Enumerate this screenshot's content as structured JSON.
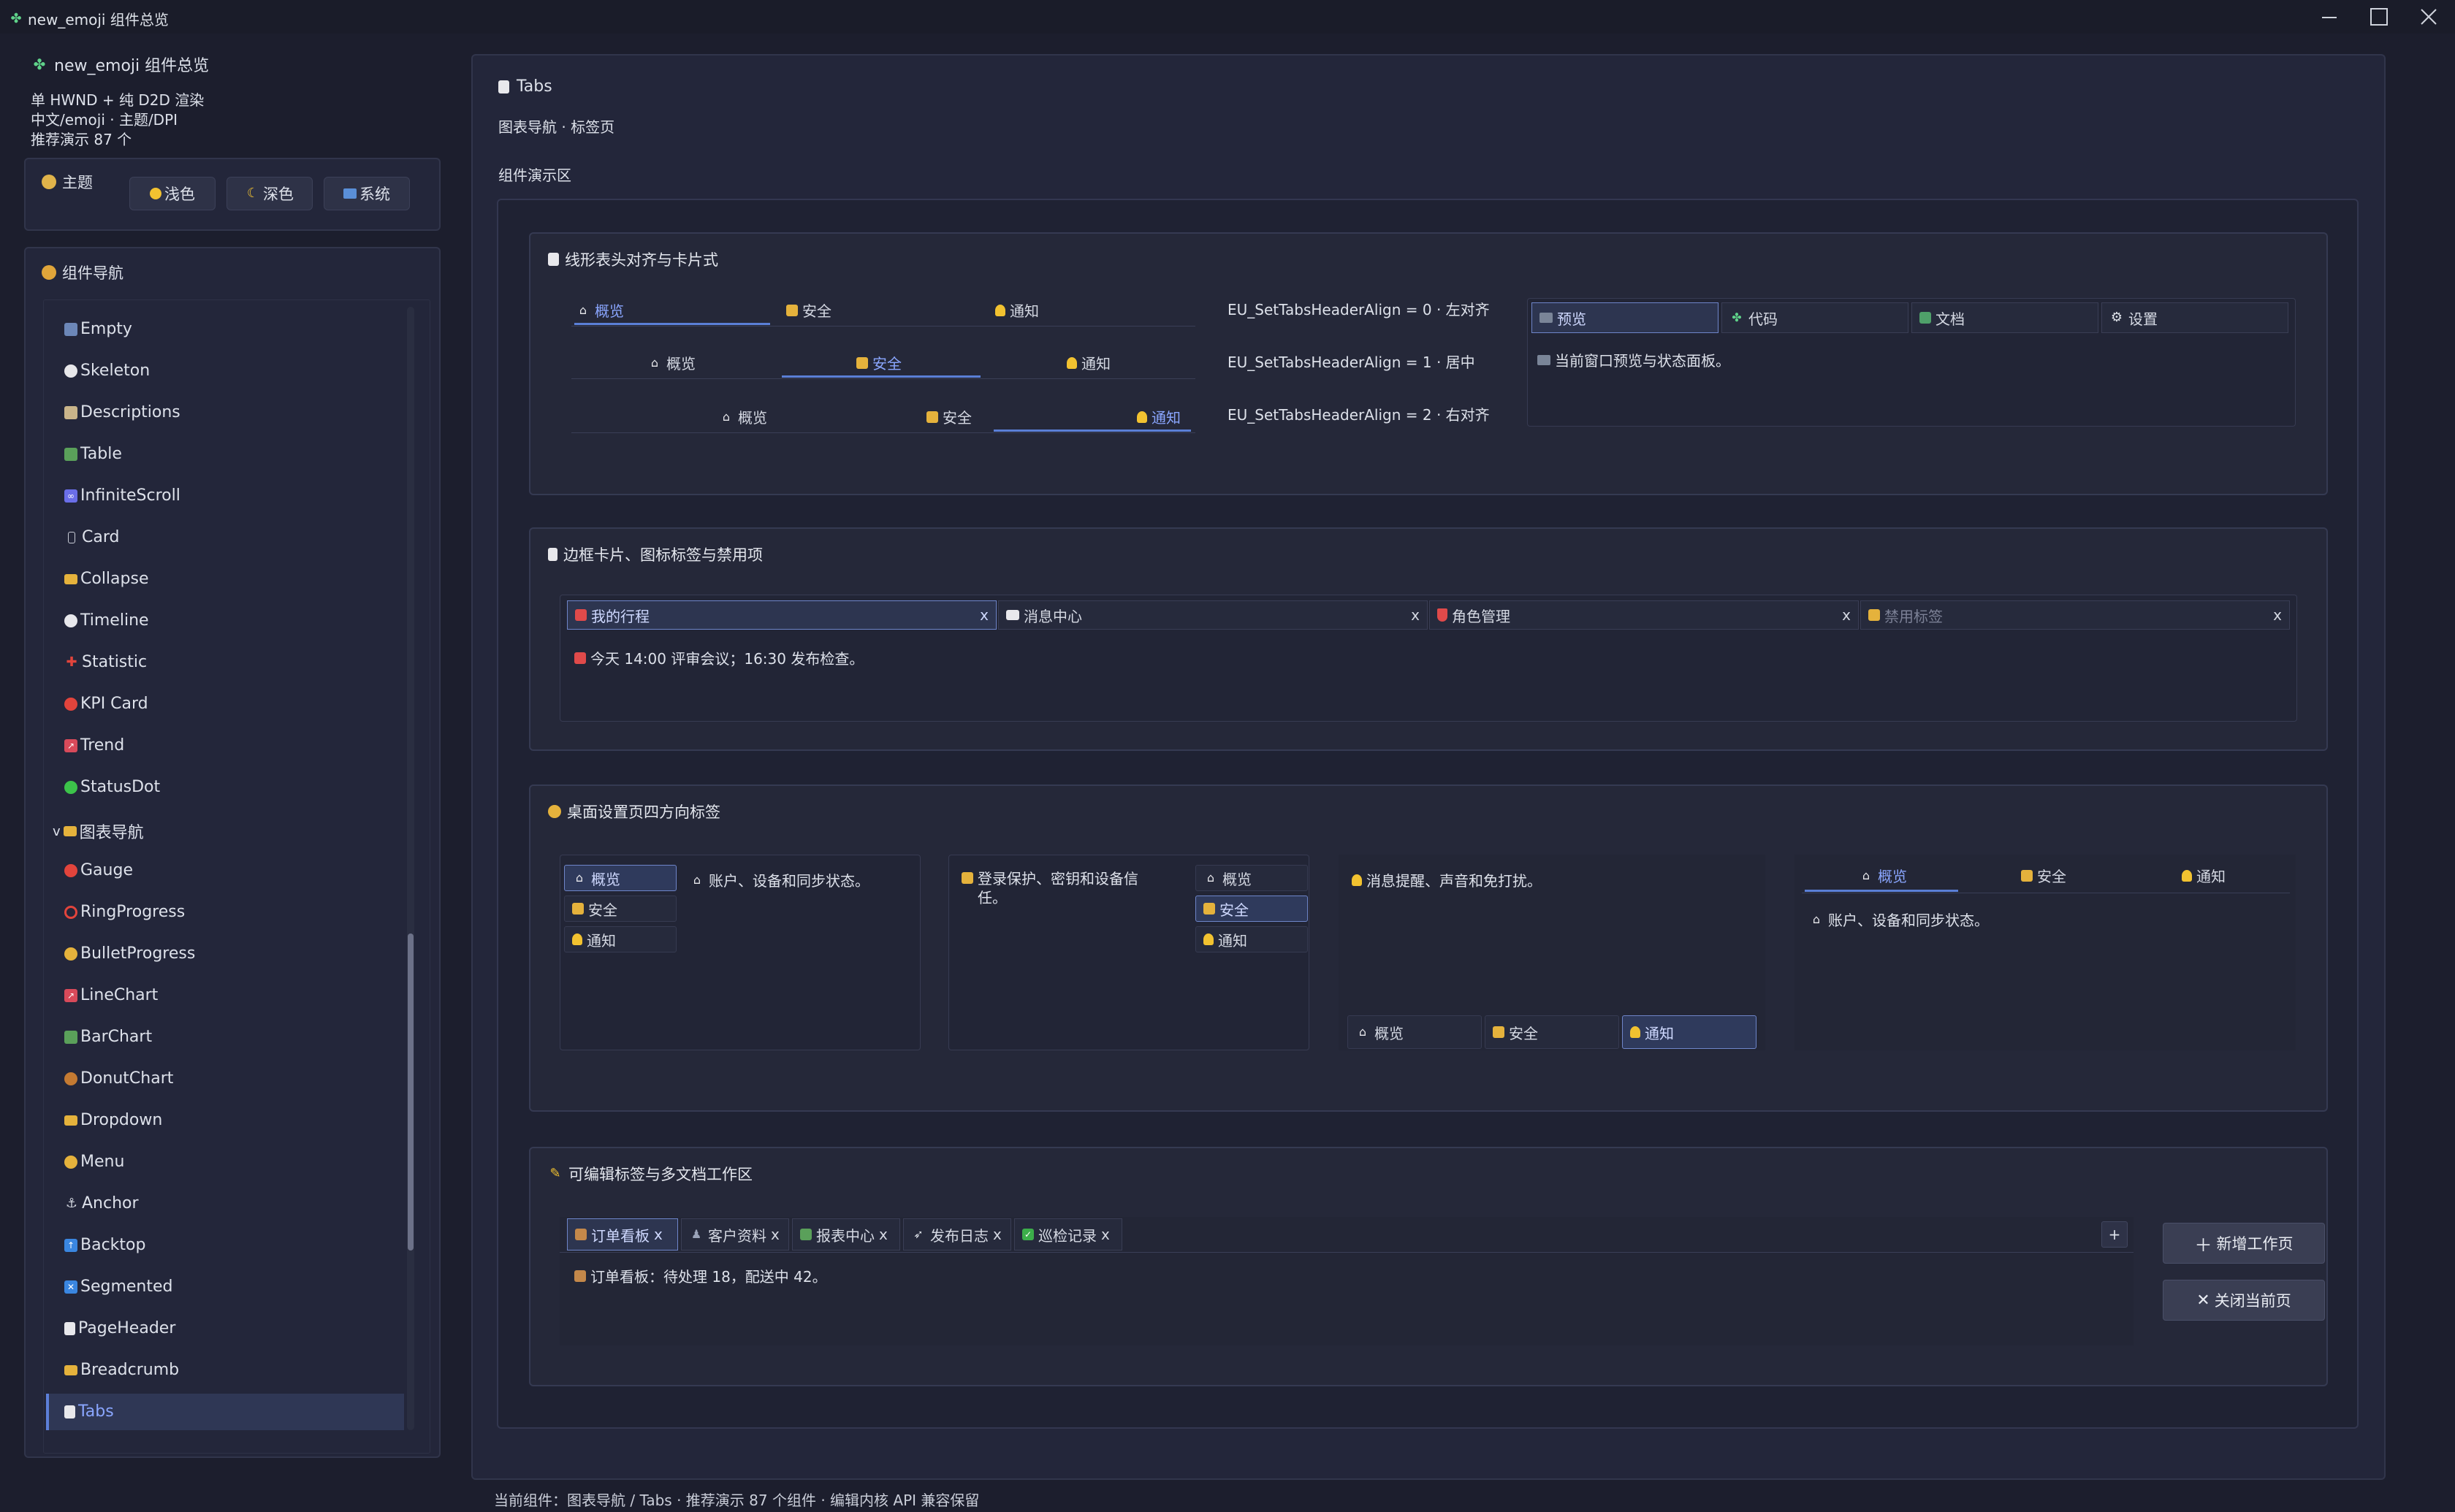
{
  "titlebar": {
    "title": "new_emoji 组件总览"
  },
  "sidebar": {
    "app_title": "new_emoji 组件总览",
    "desc_lines": [
      "单 HWND + 纯 D2D 渲染",
      "中文/emoji · 主题/DPI",
      "推荐演示 87 个"
    ],
    "theme": {
      "label": "主题",
      "buttons": [
        "浅色",
        "深色",
        "系统"
      ]
    },
    "nav": {
      "title": "组件导航",
      "items": [
        "Empty",
        "Skeleton",
        "Descriptions",
        "Table",
        "InfiniteScroll",
        "Card",
        "Collapse",
        "Timeline",
        "Statistic",
        "KPI Card",
        "Trend",
        "StatusDot",
        "图表导航",
        "Gauge",
        "RingProgress",
        "BulletProgress",
        "LineChart",
        "BarChart",
        "DonutChart",
        "Dropdown",
        "Menu",
        "Anchor",
        "Backtop",
        "Segmented",
        "PageHeader",
        "Breadcrumb",
        "Tabs"
      ],
      "group_chevron": "v",
      "selected": "Tabs"
    }
  },
  "main": {
    "title": "Tabs",
    "subtitle": "图表导航 · 标签页",
    "demo_label": "组件演示区",
    "sec1": {
      "title": "线形表头对齐与卡片式",
      "tabs": [
        "概览",
        "安全",
        "通知"
      ],
      "align_labels": [
        "EU_SetTabsHeaderAlign = 0 · 左对齐",
        "EU_SetTabsHeaderAlign = 1 · 居中",
        "EU_SetTabsHeaderAlign = 2 · 右对齐"
      ],
      "card_tabs": [
        "预览",
        "代码",
        "文档",
        "设置"
      ],
      "card_content": "当前窗口预览与状态面板。"
    },
    "sec2": {
      "title": "边框卡片、图标标签与禁用项",
      "tabs": [
        "我的行程",
        "消息中心",
        "角色管理",
        "禁用标签"
      ],
      "close": "x",
      "content": "今天 14:00 评审会议；16:30 发布检查。"
    },
    "sec3": {
      "title": "桌面设置页四方向标签",
      "tabs": [
        "概览",
        "安全",
        "通知"
      ],
      "left_content": "账户、设备和同步状态。",
      "right_content": "登录保护、密钥和设备信任。",
      "bottom_content": "消息提醒、声音和免打扰。",
      "top_content": "账户、设备和同步状态。"
    },
    "sec4": {
      "title": "可编辑标签与多文档工作区",
      "tabs": [
        "订单看板",
        "客户资料",
        "报表中心",
        "发布日志",
        "巡检记录"
      ],
      "close": "x",
      "add": "+",
      "content": "订单看板：待处理 18，配送中 42。",
      "btn_new": "新增工作页",
      "btn_close": "关闭当前页"
    }
  },
  "statusbar": {
    "text": "当前组件：图表导航 / Tabs · 推荐演示 87 个组件 · 编辑内核 API 兼容保留"
  }
}
